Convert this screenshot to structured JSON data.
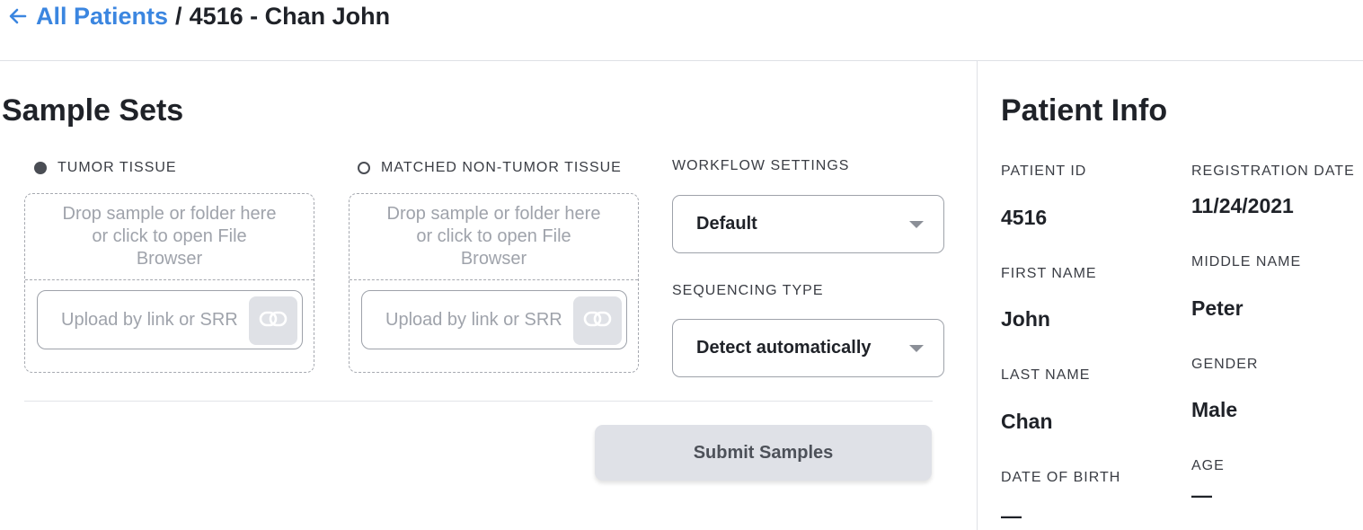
{
  "breadcrumb": {
    "back_icon": "arrow-left-icon",
    "link": "All Patients",
    "separator": "/",
    "current": "4516 - Chan John"
  },
  "sample_sets": {
    "title": "Sample Sets",
    "tumor": {
      "label": "TUMOR TISSUE",
      "selected": true,
      "drop_text": "Drop sample or folder here or click to open File Browser",
      "link_placeholder": "Upload by link or SRR",
      "link_icon": "link-icon"
    },
    "normal": {
      "label": "MATCHED NON-TUMOR TISSUE",
      "selected": false,
      "drop_text": "Drop sample or folder here or click to open File Browser",
      "link_placeholder": "Upload by link or SRR",
      "link_icon": "link-icon"
    },
    "workflow": {
      "label": "WORKFLOW SETTINGS",
      "value": "Default"
    },
    "sequencing": {
      "label": "SEQUENCING TYPE",
      "value": "Detect automatically"
    },
    "submit_label": "Submit Samples"
  },
  "patient_info": {
    "title": "Patient Info",
    "patient_id_label": "PATIENT ID",
    "patient_id": "4516",
    "registration_date_label": "REGISTRATION DATE",
    "registration_date": "11/24/2021",
    "first_name_label": "FIRST NAME",
    "first_name": "John",
    "middle_name_label": "MIDDLE NAME",
    "middle_name": "Peter",
    "last_name_label": "LAST NAME",
    "last_name": "Chan",
    "gender_label": "GENDER",
    "gender": "Male",
    "dob_label": "DATE OF BIRTH",
    "dob": "—",
    "age_label": "AGE",
    "age": "—"
  },
  "colors": {
    "link": "#3b86e0",
    "text": "#1f2228",
    "muted": "#9fa3ab",
    "button_bg": "#dfe1e7"
  }
}
